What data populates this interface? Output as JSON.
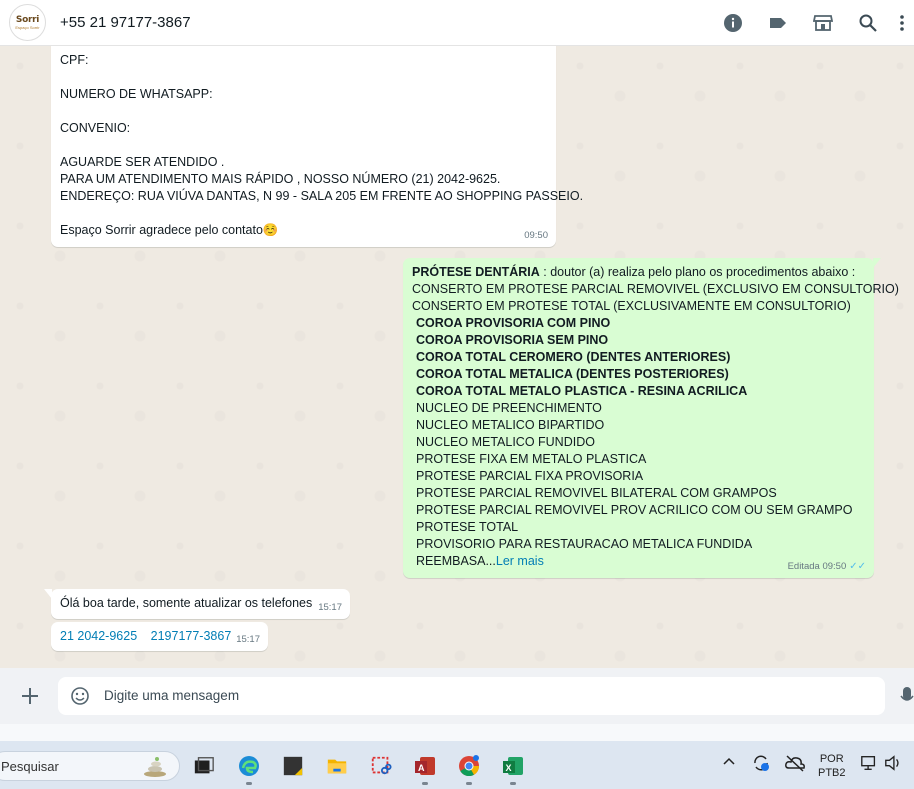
{
  "header": {
    "avatar_brand": "Sorri",
    "avatar_sub": "Espaço Sorrir",
    "contact": "+55 21 97177-3867",
    "icons": [
      "info-icon",
      "label-icon",
      "catalog-icon",
      "search-icon",
      "menu-icon"
    ]
  },
  "messages": {
    "m1": {
      "lines": [
        "CPF:",
        "",
        "NUMERO DE WHATSAPP:",
        "",
        "CONVENIO:",
        "",
        "AGUARDE SER ATENDIDO .",
        "PARA UM ATENDIMENTO MAIS RÁPIDO , NOSSO NÚMERO (21) 2042-9625.",
        "ENDEREÇO: RUA VIÚVA DANTAS, N 99 - SALA 205 EM FRENTE AO SHOPPING PASSEIO.",
        "",
        "Espaço Sorrir agradece pelo contato☺️"
      ],
      "time": "09:50"
    },
    "m2": {
      "title_bold": "PRÓTESE DENTÁRIA",
      "title_rest": " : doutor (a) realiza pelo plano os procedimentos abaixo :",
      "plain_lines": [
        "CONSERTO EM PROTESE PARCIAL REMOVIVEL (EXCLUSIVO EM CONSULTORIO)",
        "CONSERTO EM PROTESE TOTAL (EXCLUSIVAMENTE EM CONSULTORIO)"
      ],
      "bold_lines": [
        "COROA PROVISORIA COM PINO",
        "COROA PROVISORIA SEM PINO",
        "COROA TOTAL CEROMERO (DENTES ANTERIORES)",
        "COROA TOTAL METALICA (DENTES POSTERIORES)",
        "COROA TOTAL METALO PLASTICA - RESINA ACRILICA"
      ],
      "lines": [
        "NUCLEO DE PREENCHIMENTO",
        "NUCLEO METALICO BIPARTIDO",
        "NUCLEO METALICO FUNDIDO",
        "PROTESE FIXA EM METALO PLASTICA",
        "PROTESE PARCIAL FIXA PROVISORIA",
        "PROTESE PARCIAL REMOVIVEL BILATERAL COM GRAMPOS",
        "PROTESE PARCIAL REMOVIVEL PROV ACRILICO COM OU SEM GRAMPO",
        "PROTESE TOTAL",
        "PROVISORIO PARA RESTAURACAO METALICA FUNDIDA"
      ],
      "last_text": "REEMBASA...",
      "read_more": "Ler mais",
      "edited": "Editada",
      "time": "09:50",
      "ticks": "✓✓"
    },
    "m3": {
      "text": "Ólá boa tarde, somente atualizar os telefones",
      "time": "15:17"
    },
    "m4": {
      "phone1": "21 2042-9625",
      "phone2": "2197177-3867",
      "time": "15:17"
    }
  },
  "composer": {
    "placeholder": "Digite uma mensagem"
  },
  "taskbar": {
    "search_label": "Pesquisar",
    "apps": [
      "task-view",
      "edge",
      "sticky-notes",
      "file-explorer",
      "snipping-tool",
      "access",
      "chrome",
      "excel"
    ],
    "lang_line1": "POR",
    "lang_line2": "PTB2"
  }
}
